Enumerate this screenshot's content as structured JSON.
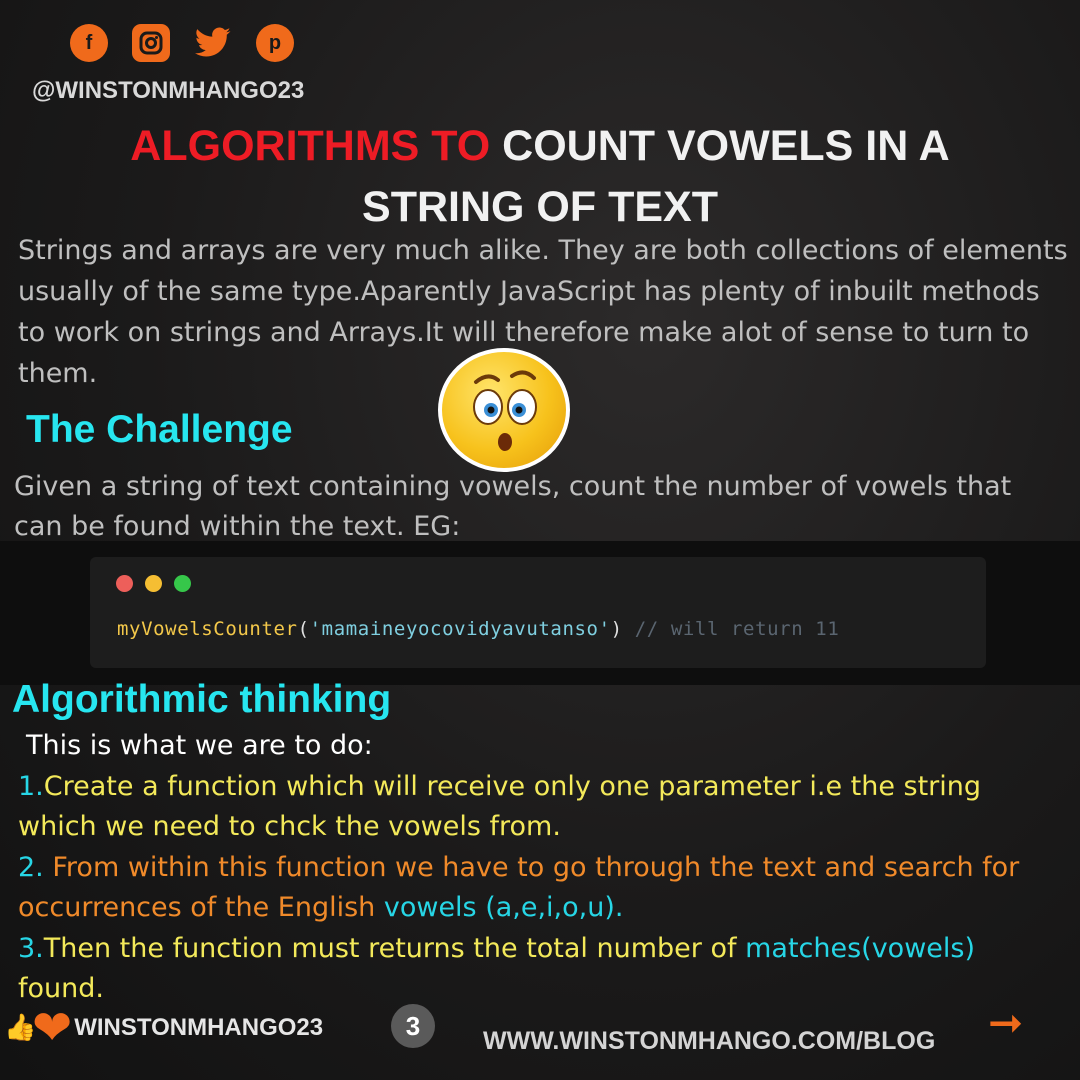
{
  "social": {
    "icons": [
      "facebook-icon",
      "instagram-icon",
      "twitter-icon",
      "pinterest-icon"
    ],
    "handle": "@WINSTONMHANGO23"
  },
  "title": {
    "part_red": "ALGORITHMS TO",
    "part_white_1": " COUNT  VOWELS IN A",
    "part_white_2": "STRING OF TEXT"
  },
  "intro": {
    "text": " Strings and arrays are very much alike. They are both collections of elements usually of the same type.Aparently JavaScript has plenty of inbuilt methods to work on strings and Arrays.It will therefore make alot of sense to turn to them."
  },
  "challenge": {
    "heading": "The Challenge",
    "text": "Given a string of text containing  vowels, count the number of vowels that can be found within the text. EG:"
  },
  "code": {
    "dot_colors": [
      "#ed5f5a",
      "#f5be33",
      "#36c74a"
    ],
    "fn": "myVowelsCounter",
    "open": "(",
    "arg": "'mamaineyocovidyavutanso'",
    "close": ")",
    "comment": " // will return 11"
  },
  "algorithm": {
    "heading": "Algorithmic thinking",
    "intro": "This is what we are to do:",
    "step1_num": "1.",
    "step1_text": "Create a function which will receive only one parameter i.e the string which we need to chck the vowels from.",
    "step2_num": "2.",
    "step2_text": " From within this function we have to go through the text and search for occurrences of the English ",
    "step2_vowels": "vowels (a,e,i,o,u).",
    "step3_num": "3.",
    "step3_text": "Then the function  must returns the total number of ",
    "step3_matches": "matches(vowels)",
    "step3_end": "found."
  },
  "footer": {
    "handle": "WINSTONMHANGO23",
    "page": "3",
    "url": "WWW.WINSTONMHANGO.COM/BLOG",
    "arrow_icon": "arrow-right-icon"
  },
  "colors": {
    "accent_orange": "#f06a1b",
    "title_red": "#ee1c25",
    "heading_cyan": "#27e6f0",
    "step_yellow": "#f3e95a"
  }
}
